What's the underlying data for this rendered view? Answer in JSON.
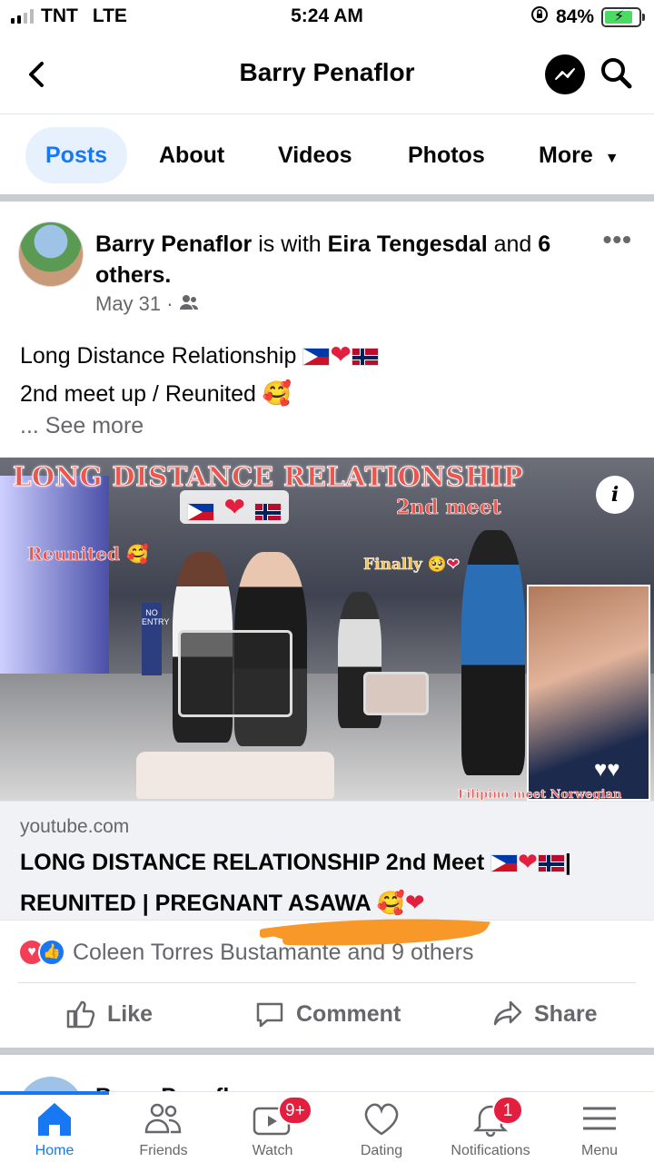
{
  "status_bar": {
    "carrier": "TNT",
    "network": "LTE",
    "time": "5:24 AM",
    "battery": "84%",
    "battery_level": 0.84
  },
  "header": {
    "title": "Barry Penaflor"
  },
  "tabs": [
    {
      "label": "Posts",
      "active": true
    },
    {
      "label": "About"
    },
    {
      "label": "Videos"
    },
    {
      "label": "Photos"
    },
    {
      "label": "More"
    }
  ],
  "post": {
    "author": "Barry Penaflor",
    "with_text": "is with",
    "tagged": "Eira Tengesdal",
    "and_text": "and",
    "others": "6 others.",
    "date": "May 31 ·",
    "line1": "Long Distance Relationship",
    "line2": "2nd meet up / Reunited",
    "see_more": "... See more",
    "preview": {
      "overlay_title": "LONG DISTANCE RELATIONSHIP",
      "tag_2nd_meet": "2nd meet",
      "tag_reunited": "Reunited",
      "tag_finally": "Finally",
      "tag_bottom": "Filipino meet Norwegian",
      "info_label": "i",
      "sign_no_entry": "NO ENTRY"
    },
    "link": {
      "domain": "youtube.com",
      "title_part1": "LONG DISTANCE RELATIONSHIP 2nd Meet",
      "title_part2": "REUNITED | PREGNANT ASAWA",
      "separator": "|"
    },
    "reactions_text": "Coleen Torres Bustamante and 9 others",
    "actions": {
      "like": "Like",
      "comment": "Comment",
      "share": "Share"
    }
  },
  "next_post": {
    "author": "Barry Penaflor"
  },
  "bottom_nav": [
    {
      "label": "Home",
      "active": true
    },
    {
      "label": "Friends"
    },
    {
      "label": "Watch",
      "badge": "9+"
    },
    {
      "label": "Dating"
    },
    {
      "label": "Notifications",
      "badge": "1"
    },
    {
      "label": "Menu"
    }
  ],
  "colors": {
    "accent": "#1877f2",
    "badge": "#e41e3f",
    "highlight_stroke": "#f7931e"
  }
}
